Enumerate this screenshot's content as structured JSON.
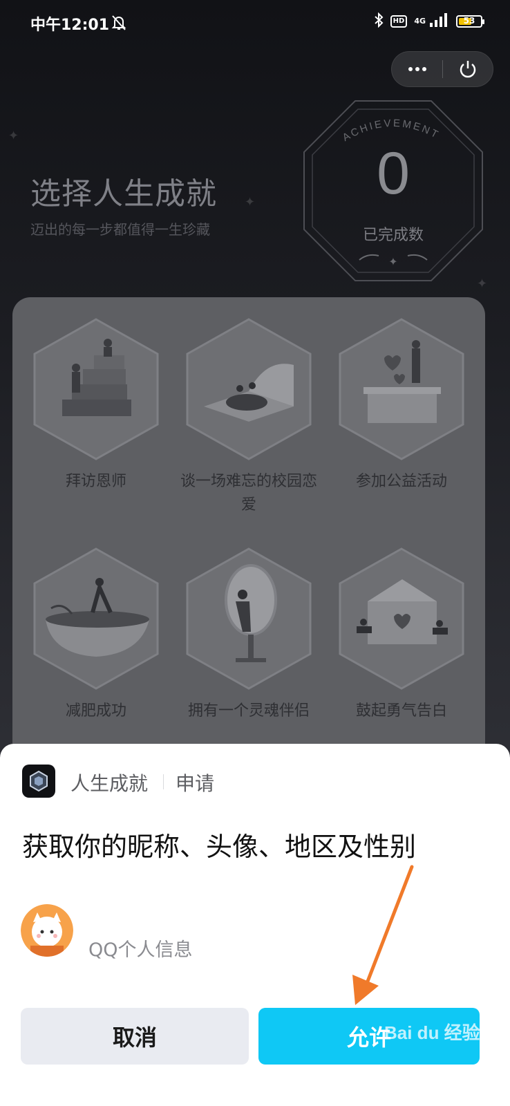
{
  "status_bar": {
    "time": "中午12:01",
    "network": "4G",
    "hd_label": "HD",
    "battery": "53"
  },
  "header": {
    "title": "选择人生成就",
    "subtitle": "迈出的每一步都值得一生珍藏"
  },
  "badge": {
    "arc_text": "ACHIEVEMENT",
    "count": "0",
    "label": "已完成数"
  },
  "achievements": [
    {
      "label": "拜访恩师",
      "icon": "teacher-stairs-illustration"
    },
    {
      "label": "谈一场难忘的校园恋爱",
      "icon": "campus-love-book-illustration"
    },
    {
      "label": "参加公益活动",
      "icon": "charity-hearts-illustration"
    },
    {
      "label": "减肥成功",
      "icon": "yoga-bowl-illustration"
    },
    {
      "label": "拥有一个灵魂伴侣",
      "icon": "mirror-girl-illustration"
    },
    {
      "label": "鼓起勇气告白",
      "icon": "love-letter-illustration"
    }
  ],
  "sheet": {
    "app_name": "人生成就",
    "apply": "申请",
    "title": "获取你的昵称、头像、地区及性别",
    "info_label": "QQ个人信息",
    "cancel": "取消",
    "allow": "允许"
  },
  "watermark": "Bai du 经验",
  "colors": {
    "allow_button": "#0fc8f5",
    "cancel_button": "#e9ebf1",
    "annotation_arrow": "#f07a2a",
    "battery": "#f2c200"
  }
}
